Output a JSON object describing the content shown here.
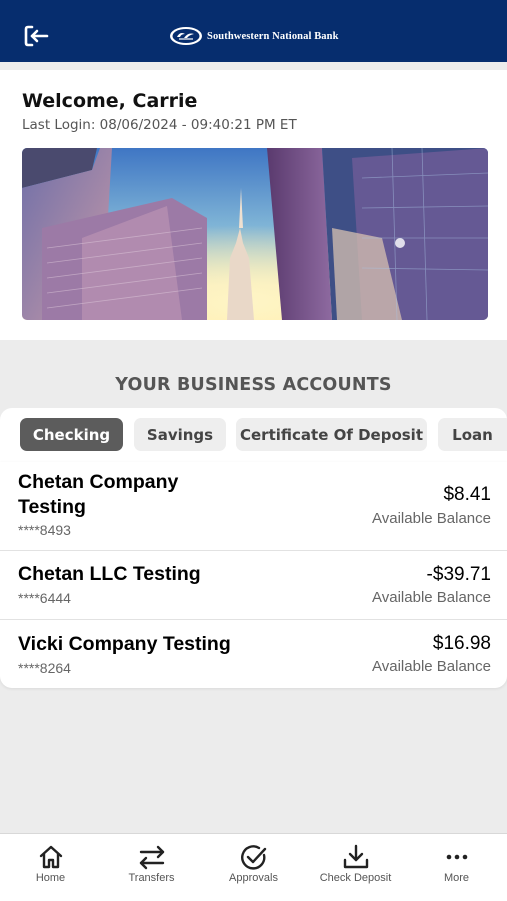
{
  "header": {
    "logout_icon": "logout-icon",
    "bank_name": "Southwestern National Bank"
  },
  "welcome": {
    "title": "Welcome, Carrie",
    "last_login": "Last Login: 08/06/2024 - 09:40:21 PM ET"
  },
  "accounts_section": {
    "title": "YOUR BUSINESS ACCOUNTS",
    "tabs": [
      {
        "label": "Checking",
        "active": true
      },
      {
        "label": "Savings",
        "active": false
      },
      {
        "label": "Certificate Of Deposit",
        "active": false
      },
      {
        "label": "Loan",
        "active": false
      }
    ],
    "accounts": [
      {
        "name_line1": "Chetan Company",
        "name_line2": "Testing",
        "number": "****8493",
        "balance": "$8.41",
        "balance_label": "Available Balance"
      },
      {
        "name_line1": "Chetan LLC Testing",
        "number": "****6444",
        "balance": "-$39.71",
        "balance_label": "Available Balance"
      },
      {
        "name_line1": "Vicki Company Testing",
        "number": "****8264",
        "balance": "$16.98",
        "balance_label": "Available Balance"
      }
    ]
  },
  "bottom_nav": [
    {
      "label": "Home",
      "icon": "home-icon"
    },
    {
      "label": "Transfers",
      "icon": "transfer-arrows-icon"
    },
    {
      "label": "Approvals",
      "icon": "check-circle-icon"
    },
    {
      "label": "Check Deposit",
      "icon": "download-tray-icon"
    },
    {
      "label": "More",
      "icon": "more-dots-icon"
    }
  ],
  "colors": {
    "header_bg": "#062d6e",
    "active_tab": "#5c5c5c",
    "page_bg": "#ececec"
  }
}
